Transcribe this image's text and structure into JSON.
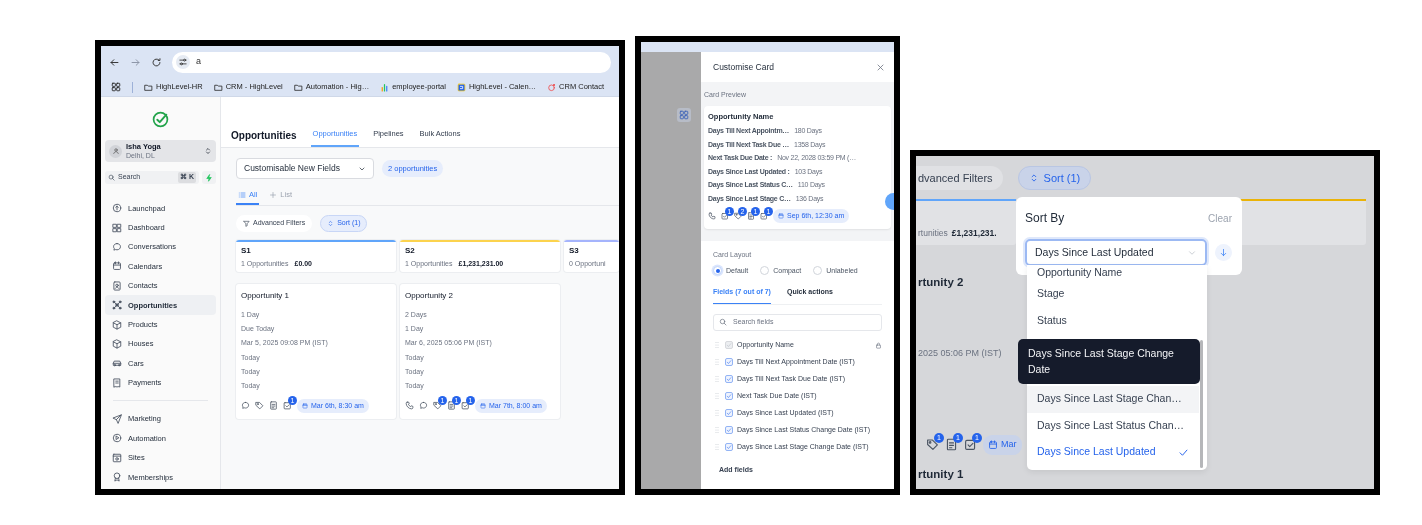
{
  "browser": {
    "address": "a",
    "bookmarks": [
      {
        "kind": "folder",
        "label": "HighLevel-HR"
      },
      {
        "kind": "folder",
        "label": "CRM - HighLevel"
      },
      {
        "kind": "folder",
        "label": "Automation - Hig…"
      },
      {
        "kind": "chart",
        "label": "employee-portal"
      },
      {
        "kind": "calbox",
        "label": "HighLevel - Calen…"
      },
      {
        "kind": "crm",
        "label": "CRM Contact"
      }
    ]
  },
  "sidebar": {
    "account": {
      "name": "Isha Yoga",
      "location": "Delhi, DL"
    },
    "search": {
      "placeholder": "Search",
      "shortcut": "⌘ K"
    },
    "sections": [
      {
        "items": [
          {
            "label": "Launchpad",
            "selected": false
          },
          {
            "label": "Dashboard",
            "selected": false
          },
          {
            "label": "Conversations",
            "selected": false
          },
          {
            "label": "Calendars",
            "selected": false
          },
          {
            "label": "Contacts",
            "selected": false
          },
          {
            "label": "Opportunities",
            "selected": true
          },
          {
            "label": "Products",
            "selected": false
          },
          {
            "label": "Houses",
            "selected": false
          },
          {
            "label": "Cars",
            "selected": false
          },
          {
            "label": "Payments",
            "selected": false
          }
        ]
      },
      {
        "items": [
          {
            "label": "Marketing",
            "selected": false
          },
          {
            "label": "Automation",
            "selected": false
          },
          {
            "label": "Sites",
            "selected": false
          },
          {
            "label": "Memberships",
            "selected": false
          }
        ]
      }
    ]
  },
  "main": {
    "title": "Opportunities",
    "tabs": [
      {
        "label": "Opportunities",
        "selected": true
      },
      {
        "label": "Pipelines",
        "selected": false
      },
      {
        "label": "Bulk Actions",
        "selected": false
      }
    ],
    "pipeline": "Customisable New Fields",
    "count": "2 opportunities",
    "views": [
      {
        "kind": "all",
        "label": "All",
        "selected": true
      },
      {
        "kind": "add",
        "label": "List",
        "selected": false
      }
    ],
    "filters": {
      "advanced": "Advanced Filters",
      "sort": "Sort (1)"
    },
    "stages": [
      {
        "name": "S1",
        "count": "1 Opportunities",
        "value": "£0.00",
        "color": "#60a5fa"
      },
      {
        "name": "S2",
        "count": "1 Opportunities",
        "value": "£1,231,231.00",
        "color": "#fcd34d"
      },
      {
        "name": "S3",
        "count": "0 Opportuni",
        "color": "#a5b4fc"
      }
    ],
    "cards": [
      {
        "title": "Opportunity 1",
        "lines": [
          "1 Day",
          "Due Today",
          "Mar 5, 2025 09:08 PM (IST)",
          "Today",
          "Today",
          "Today"
        ],
        "actions": [
          {
            "kind": "chat"
          },
          {
            "kind": "tag"
          },
          {
            "kind": "note"
          },
          {
            "kind": "task",
            "badge": "1"
          }
        ],
        "date": "Mar 6th, 8:30 am"
      },
      {
        "title": "Opportunity 2",
        "lines": [
          "2 Days",
          "1 Day",
          "Mar 6, 2025 05:06 PM (IST)",
          "Today",
          "Today",
          "Today"
        ],
        "actions": [
          {
            "kind": "phone"
          },
          {
            "kind": "chat"
          },
          {
            "kind": "tag",
            "badge": "1"
          },
          {
            "kind": "note",
            "badge": "1"
          },
          {
            "kind": "task",
            "badge": "1"
          }
        ],
        "date": "Mar 7th, 8:00 am"
      }
    ]
  },
  "customise": {
    "title": "Customise Card",
    "preview_label": "Card Preview",
    "preview": {
      "title": "Opportunity Name",
      "rows": [
        {
          "label": "Days Till Next Appointm…",
          "value": "180 Days"
        },
        {
          "label": "Days Till Next Task Due …",
          "value": "1358 Days"
        },
        {
          "label": "Next Task Due Date :",
          "value": "Nov 22, 2028 03:59 PM (…"
        },
        {
          "label": "Days Since Last Updated :",
          "value": "103 Days"
        },
        {
          "label": "Days Since Last Status C…",
          "value": "110 Days"
        },
        {
          "label": "Days Since Last Stage C…",
          "value": "136 Days"
        }
      ],
      "actions": [
        {
          "kind": "phone"
        },
        {
          "kind": "task",
          "badge": "1"
        },
        {
          "kind": "tag",
          "badge": "2"
        },
        {
          "kind": "note",
          "badge": "1"
        },
        {
          "kind": "task",
          "badge": "1"
        }
      ],
      "date": "Sep 6th, 12:30 am"
    },
    "layout_label": "Card Layout",
    "layouts": [
      {
        "label": "Default",
        "selected": true
      },
      {
        "label": "Compact",
        "selected": false
      },
      {
        "label": "Unlabeled",
        "selected": false
      }
    ],
    "tabs": [
      {
        "label": "Fields (7 out of 7)",
        "selected": true
      },
      {
        "label": "Quick actions",
        "selected": false
      }
    ],
    "search": {
      "placeholder": "Search fields"
    },
    "fields": [
      {
        "label": "Opportunity Name",
        "checked": true,
        "disabled": true,
        "locked": true
      },
      {
        "label": "Days Till Next Appointment Date (IST)",
        "checked": true,
        "disabled": false,
        "locked": false
      },
      {
        "label": "Days Till Next Task Due Date (IST)",
        "checked": true,
        "disabled": false,
        "locked": false
      },
      {
        "label": "Next Task Due Date (IST)",
        "checked": true,
        "disabled": false,
        "locked": false
      },
      {
        "label": "Days Since Last Updated (IST)",
        "checked": true,
        "disabled": false,
        "locked": false
      },
      {
        "label": "Days Since Last Status Change Date (IST)",
        "checked": true,
        "disabled": false,
        "locked": false
      },
      {
        "label": "Days Since Last Stage Change Date (IST)",
        "checked": true,
        "disabled": false,
        "locked": false
      }
    ],
    "add": "Add fields"
  },
  "sort_view": {
    "advanced": "dvanced Filters",
    "sort": "Sort (1)",
    "stage": {
      "count": "rtunities",
      "value": "£1,231,231."
    },
    "cards": [
      {
        "title": "rtunity 2",
        "date": "2025 05:06 PM (IST)",
        "actions": [
          {
            "kind": "tag",
            "badge": "1"
          },
          {
            "kind": "note",
            "badge": "1"
          },
          {
            "kind": "task",
            "badge": "1"
          }
        ],
        "chip": "Mar"
      },
      {
        "title": "rtunity 1"
      }
    ],
    "popover": {
      "title": "Sort By",
      "clear": "Clear",
      "value": "Days Since Last Updated",
      "tooltip": "Days Since Last Stage Change Date",
      "options": [
        {
          "label": "Opportunity Name",
          "selected": false,
          "highlighted": false
        },
        {
          "label": "Stage",
          "selected": false,
          "highlighted": false
        },
        {
          "label": "Status",
          "selected": false,
          "highlighted": false
        },
        {
          "label": "Days Since Last Stage Chan…",
          "selected": false,
          "highlighted": true
        },
        {
          "label": "Days Since Last Status Chan…",
          "selected": false,
          "highlighted": false
        },
        {
          "label": "Days Since Last Updated",
          "selected": true,
          "highlighted": false
        }
      ]
    }
  }
}
